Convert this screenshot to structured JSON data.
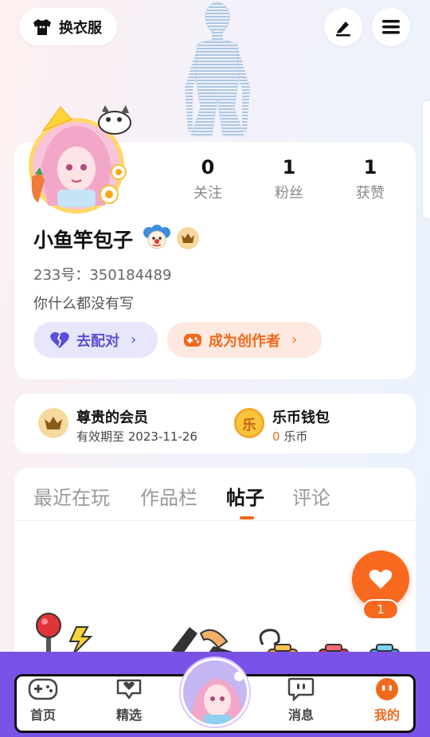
{
  "header": {
    "wardrobe_label": "换衣服",
    "wardrobe_icon": "shirt-icon",
    "edit_icon": "pen-icon",
    "menu_icon": "menu-icon"
  },
  "profile": {
    "stats": [
      {
        "value": "0",
        "label": "关注"
      },
      {
        "value": "1",
        "label": "粉丝"
      },
      {
        "value": "1",
        "label": "获赞"
      }
    ],
    "username": "小鱼竿包子",
    "uid": "233号：350184489",
    "bio": "你什么都没有写",
    "pair_label": "去配对",
    "creator_label": "成为创作者",
    "chevron": "›"
  },
  "membership": {
    "vip_title": "尊贵的会员",
    "vip_sub": "有效期至 2023-11-26",
    "coin_glyph": "乐",
    "wallet_title": "乐币钱包",
    "wallet_amount": "0",
    "wallet_unit": "乐币"
  },
  "tabs": [
    {
      "label": "最近在玩",
      "active": false
    },
    {
      "label": "作品栏",
      "active": false
    },
    {
      "label": "帖子",
      "active": true
    },
    {
      "label": "评论",
      "active": false
    }
  ],
  "like": {
    "count": "1",
    "icon": "heart-icon"
  },
  "nav": [
    {
      "label": "首页",
      "icon": "gamepad-icon",
      "active": false
    },
    {
      "label": "精选",
      "icon": "heart-badge-icon",
      "active": false
    },
    {
      "label": "消息",
      "icon": "chat-bubble-icon",
      "active": false
    },
    {
      "label": "我的",
      "icon": "face-icon",
      "active": true
    }
  ],
  "colors": {
    "accent": "#f06a1d",
    "purple": "#7b52e8",
    "pair_text": "#5a4fd6"
  }
}
